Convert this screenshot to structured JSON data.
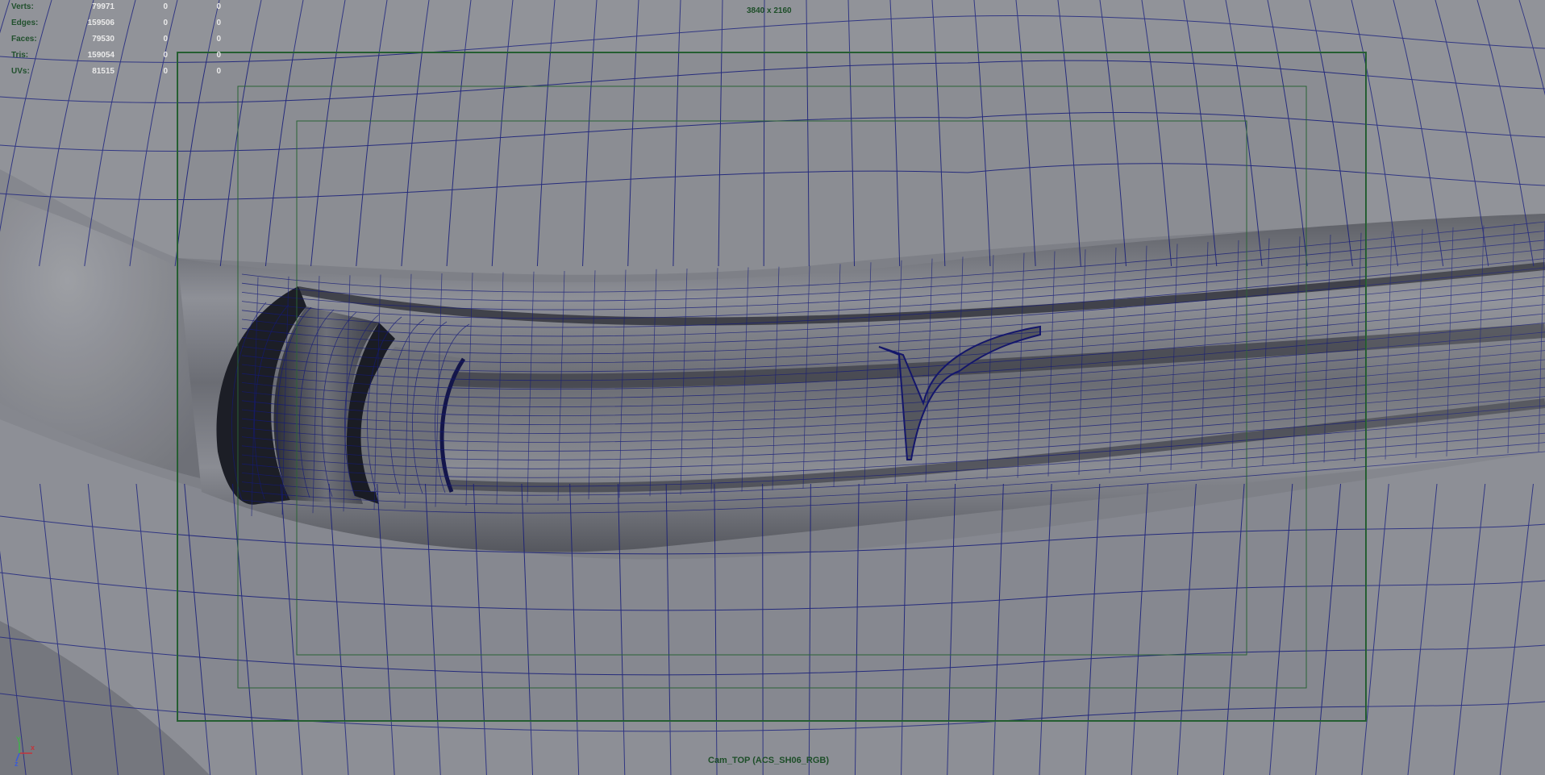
{
  "hud": {
    "stats": [
      {
        "label": "Verts:",
        "values": [
          "79971",
          "0",
          "0"
        ]
      },
      {
        "label": "Edges:",
        "values": [
          "159506",
          "0",
          "0"
        ]
      },
      {
        "label": "Faces:",
        "values": [
          "79530",
          "0",
          "0"
        ]
      },
      {
        "label": "Tris:",
        "values": [
          "159054",
          "0",
          "0"
        ]
      },
      {
        "label": "UVs:",
        "values": [
          "81515",
          "0",
          "0"
        ]
      }
    ],
    "resolution": "3840 x 2160",
    "camera_name": "Cam_TOP (ACS_SH06_RGB)"
  },
  "axis_gizmo": {
    "y_label": "Y",
    "x_label": "x",
    "z_label": "z"
  },
  "colors": {
    "wireframe": "#141a78",
    "resolution_gate": "#1f5a2c",
    "surface": "#7f8188",
    "stats_label": "#21502d",
    "stats_value": "#eaeaea"
  }
}
